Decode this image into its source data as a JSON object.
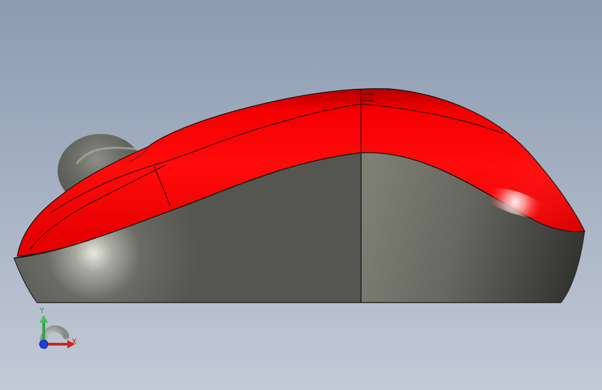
{
  "viewport": {
    "background_top": "#8c9bb0",
    "background_bottom": "#c2cad6"
  },
  "model": {
    "shell_color": "#ff0000",
    "base_color": "#5f5f59",
    "wheel_color": "#6a6b64"
  },
  "triad": {
    "x_label": "X",
    "y_label": "Y",
    "x_color": "#d3231f",
    "y_color": "#2ea44a",
    "z_color": "#1c3fe0"
  }
}
